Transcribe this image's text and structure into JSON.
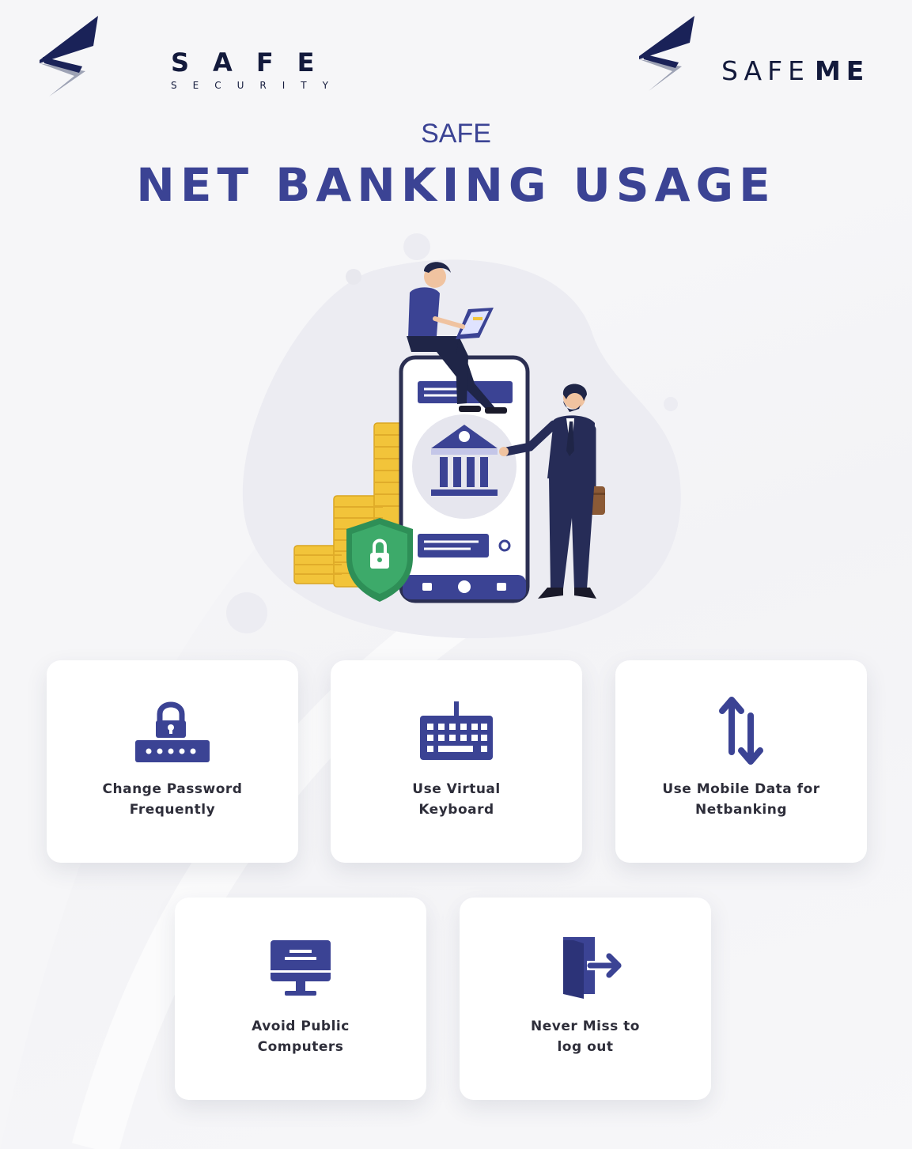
{
  "brand_left": {
    "name": "SAFE",
    "tagline": "SECURITY"
  },
  "brand_right": {
    "name_light": "SAFE",
    "name_bold": "ME"
  },
  "header": {
    "kicker": "SAFE",
    "title": "NET BANKING USAGE"
  },
  "colors": {
    "primary": "#3b4394",
    "dark": "#131a3c",
    "shield": "#3daa6a",
    "coin": "#f2c43a"
  },
  "tips": [
    {
      "label": "Change Password\nFrequently",
      "icon": "password-lock-icon"
    },
    {
      "label": "Use Virtual\nKeyboard",
      "icon": "keyboard-icon"
    },
    {
      "label": "Use Mobile Data for\nNetbanking",
      "icon": "data-transfer-arrows-icon"
    },
    {
      "label": "Avoid Public\nComputers",
      "icon": "desktop-computer-icon"
    },
    {
      "label": "Never Miss to\nlog out",
      "icon": "logout-door-icon"
    }
  ]
}
